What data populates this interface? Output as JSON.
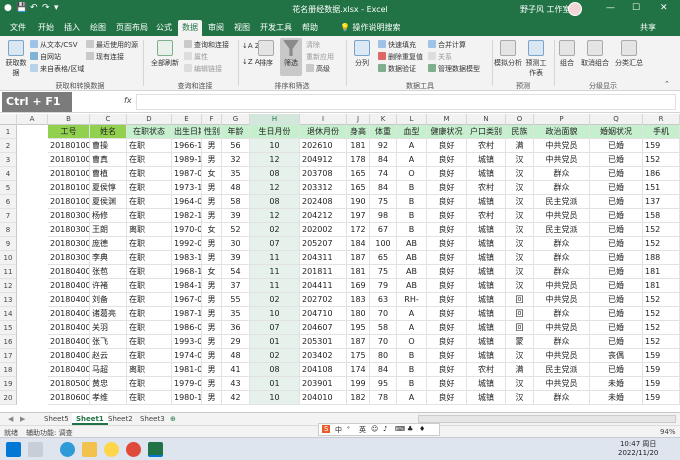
{
  "titlebar": {
    "title": "花名册经数据.xlsx  -  Excel",
    "user": "野子风 工作室",
    "autosave": "自动保存",
    "qa_icons": [
      "save-icon",
      "undo-icon",
      "redo-icon",
      "customize-icon"
    ],
    "win_buttons": [
      "—",
      "☐",
      "✕"
    ]
  },
  "tabs": [
    "文件",
    "开始",
    "插入",
    "绘图",
    "页面布局",
    "公式",
    "数据",
    "审阅",
    "视图",
    "开发工具",
    "帮助"
  ],
  "active_tab": "数据",
  "search": "操作说明搜索",
  "share": "共享",
  "ribbon": {
    "get_data": {
      "label": "获取数据",
      "items": [
        "从文本/CSV",
        "自网站",
        "来自表格/区域"
      ],
      "recent": [
        "最近使用的源",
        "现有连接"
      ],
      "group": "获取和转换数据"
    },
    "queries": {
      "refresh": "全部刷新",
      "items": [
        "查询和连接",
        "属性",
        "编辑链接"
      ],
      "group": "查询和连接"
    },
    "sort": {
      "az": "↓A Z",
      "za": "↓Z A",
      "sort": "排序",
      "filter": "筛选",
      "clear": "清除",
      "reapply": "重新应用",
      "advanced": "高级",
      "group": "排序和筛选"
    },
    "tools": {
      "split": "分列",
      "items": [
        "快速填充",
        "删除重复值",
        "数据验证"
      ],
      "items2": [
        "合并计算",
        "关系",
        "管理数据模型"
      ],
      "group": "数据工具"
    },
    "forecast": {
      "whatif": "模拟分析",
      "sheet": "预测工作表",
      "group": "预测"
    },
    "outline": {
      "group_btn": "组合",
      "ungroup": "取消组合",
      "subtotal": "分类汇总",
      "group": "分级显示"
    }
  },
  "overlay_key": "Ctrl + F1",
  "formula": {
    "fx": "fx",
    "value": ""
  },
  "columns": [
    "A",
    "B",
    "C",
    "D",
    "E",
    "F",
    "G",
    "H",
    "I",
    "J",
    "K",
    "L",
    "M",
    "N",
    "O",
    "P",
    "Q",
    "R"
  ],
  "selected_column": "H",
  "headers": [
    "工号",
    "姓名",
    "在职状态",
    "出生日期",
    "性别",
    "年龄",
    "生日月份",
    "退休月份",
    "身高",
    "体重",
    "血型",
    "健康状况",
    "户口类别",
    "民族",
    "政治面貌",
    "婚姻状况",
    "手机"
  ],
  "rows": [
    {
      "n": "2",
      "c": [
        "201801001",
        "曹操",
        "在职",
        "1966-10-29",
        "男",
        "56",
        "10",
        "202610",
        "181",
        "92",
        "A",
        "良好",
        "农村",
        "满",
        "中共党员",
        "已婚",
        "159"
      ]
    },
    {
      "n": "3",
      "c": [
        "201801002",
        "曹真",
        "在职",
        "1989-12-26",
        "男",
        "32",
        "12",
        "204912",
        "178",
        "84",
        "A",
        "良好",
        "城镇",
        "汉",
        "中共党员",
        "已婚",
        "152"
      ]
    },
    {
      "n": "4",
      "c": [
        "201801003",
        "曹植",
        "在职",
        "1987-08-30",
        "女",
        "35",
        "08",
        "203708",
        "165",
        "74",
        "O",
        "良好",
        "城镇",
        "汉",
        "群众",
        "已婚",
        "186"
      ]
    },
    {
      "n": "5",
      "c": [
        "201801004",
        "夏侯惇",
        "在职",
        "1973-12-17",
        "男",
        "48",
        "12",
        "203312",
        "165",
        "84",
        "B",
        "良好",
        "农村",
        "汉",
        "群众",
        "已婚",
        "151"
      ]
    },
    {
      "n": "6",
      "c": [
        "201801005",
        "夏侯渊",
        "在职",
        "1964-08-22",
        "男",
        "58",
        "08",
        "202408",
        "190",
        "75",
        "B",
        "良好",
        "城镇",
        "汉",
        "民主党派",
        "已婚",
        "137"
      ]
    },
    {
      "n": "7",
      "c": [
        "201803001",
        "杨修",
        "在职",
        "1982-12-07",
        "男",
        "39",
        "12",
        "204212",
        "197",
        "98",
        "B",
        "良好",
        "农村",
        "汉",
        "中共党员",
        "已婚",
        "158"
      ]
    },
    {
      "n": "8",
      "c": [
        "201803002",
        "王朗",
        "离职",
        "1970-02-12",
        "女",
        "52",
        "02",
        "202002",
        "172",
        "67",
        "B",
        "良好",
        "城镇",
        "汉",
        "民主党派",
        "已婚",
        "152"
      ]
    },
    {
      "n": "9",
      "c": [
        "201803003",
        "庞德",
        "在职",
        "1992-07-25",
        "男",
        "30",
        "07",
        "205207",
        "184",
        "100",
        "AB",
        "良好",
        "城镇",
        "汉",
        "群众",
        "已婚",
        "152"
      ]
    },
    {
      "n": "10",
      "c": [
        "201803004",
        "李典",
        "在职",
        "1983-11-04",
        "男",
        "39",
        "11",
        "204311",
        "187",
        "65",
        "AB",
        "良好",
        "城镇",
        "汉",
        "群众",
        "已婚",
        "188"
      ]
    },
    {
      "n": "11",
      "c": [
        "201804001",
        "张苞",
        "在职",
        "1968-11-03",
        "女",
        "54",
        "11",
        "201811",
        "181",
        "75",
        "AB",
        "良好",
        "城镇",
        "汉",
        "群众",
        "已婚",
        "181"
      ]
    },
    {
      "n": "12",
      "c": [
        "201804002",
        "许褚",
        "在职",
        "1984-11-29",
        "男",
        "37",
        "11",
        "204411",
        "169",
        "79",
        "AB",
        "良好",
        "城镇",
        "汉",
        "中共党员",
        "已婚",
        "181"
      ]
    },
    {
      "n": "13",
      "c": [
        "201804004",
        "刘备",
        "在职",
        "1967-02-16",
        "男",
        "55",
        "02",
        "202702",
        "183",
        "63",
        "RH-",
        "良好",
        "城镇",
        "回",
        "中共党员",
        "已婚",
        "152"
      ]
    },
    {
      "n": "14",
      "c": [
        "201804005",
        "诸葛亮",
        "在职",
        "1987-10-04",
        "男",
        "35",
        "10",
        "204710",
        "180",
        "70",
        "A",
        "良好",
        "城镇",
        "回",
        "群众",
        "已婚",
        "152"
      ]
    },
    {
      "n": "15",
      "c": [
        "201804006",
        "关羽",
        "在职",
        "1986-07-16",
        "男",
        "36",
        "07",
        "204607",
        "195",
        "58",
        "A",
        "良好",
        "城镇",
        "回",
        "中共党员",
        "已婚",
        "152"
      ]
    },
    {
      "n": "16",
      "c": [
        "201804007",
        "张飞",
        "在职",
        "1993-01-03",
        "男",
        "29",
        "01",
        "205301",
        "187",
        "70",
        "O",
        "良好",
        "城镇",
        "蒙",
        "群众",
        "已婚",
        "152"
      ]
    },
    {
      "n": "17",
      "c": [
        "201804008",
        "赵云",
        "在职",
        "1974-02-17",
        "男",
        "48",
        "02",
        "203402",
        "175",
        "80",
        "B",
        "良好",
        "城镇",
        "汉",
        "中共党员",
        "丧偶",
        "159"
      ]
    },
    {
      "n": "18",
      "c": [
        "201804009",
        "马超",
        "离职",
        "1981-08-15",
        "男",
        "41",
        "08",
        "204108",
        "174",
        "84",
        "B",
        "良好",
        "农村",
        "满",
        "民主党派",
        "已婚",
        "159"
      ]
    },
    {
      "n": "19",
      "c": [
        "201805001",
        "黄忠",
        "在职",
        "1979-01-10",
        "男",
        "43",
        "01",
        "203901",
        "199",
        "95",
        "B",
        "良好",
        "城镇",
        "汉",
        "中共党员",
        "未婚",
        "159"
      ]
    },
    {
      "n": "20",
      "c": [
        "201806001",
        "孝维",
        "在职",
        "1980-10-03",
        "男",
        "42",
        "10",
        "204010",
        "182",
        "78",
        "A",
        "良好",
        "城镇",
        "汉",
        "群众",
        "未婚",
        "159"
      ]
    }
  ],
  "sheets": [
    "Sheet5",
    "Sheet1",
    "Sheet2",
    "Sheet3"
  ],
  "active_sheet": "Sheet1",
  "status": {
    "ready": "就绪",
    "accessibility": "辅助功能: 调查",
    "zoom": "94%"
  },
  "ime": [
    "中",
    "ᐤ",
    "英",
    "☺",
    "♪",
    "⌨",
    "♣",
    "♦"
  ],
  "clock": {
    "time": "10:47 周日",
    "date": "2022/11/20"
  },
  "colors": {
    "excel_green": "#217346",
    "header_fill": "#c6efce",
    "key_fill": "#92d050"
  }
}
